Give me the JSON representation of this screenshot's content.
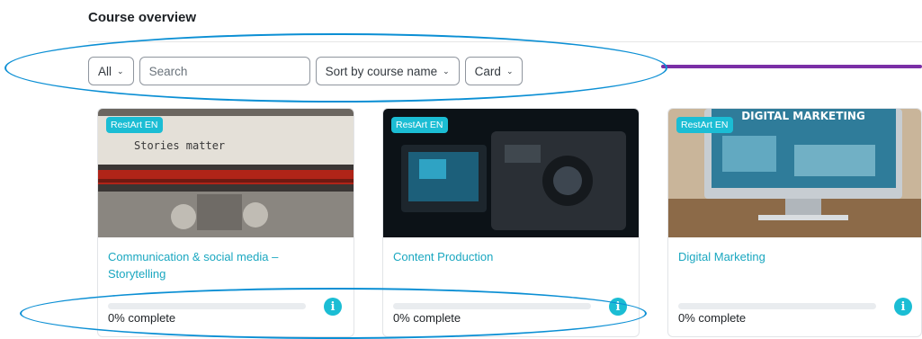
{
  "header": {
    "title": "Course overview"
  },
  "filters": {
    "grouping": "All",
    "search_placeholder": "Search",
    "sort": "Sort by course name",
    "view": "Card"
  },
  "courses": [
    {
      "category": "RestArt EN",
      "title": "Communication & social media – Storytelling",
      "progress_label": "0% complete",
      "progress": 0,
      "image_text": "Stories matter"
    },
    {
      "category": "RestArt EN",
      "title": "Content Production",
      "progress_label": "0% complete",
      "progress": 0
    },
    {
      "category": "RestArt EN",
      "title": "Digital Marketing",
      "progress_label": "0% complete",
      "progress": 0,
      "image_text": "DIGITAL MARKETING"
    }
  ],
  "icons": {
    "info": "info-icon",
    "dropdown": "chevron-down-icon"
  },
  "colors": {
    "accent": "#1bbdd4",
    "annotation": "#0b8fd4",
    "purple": "#7b2fa6"
  }
}
